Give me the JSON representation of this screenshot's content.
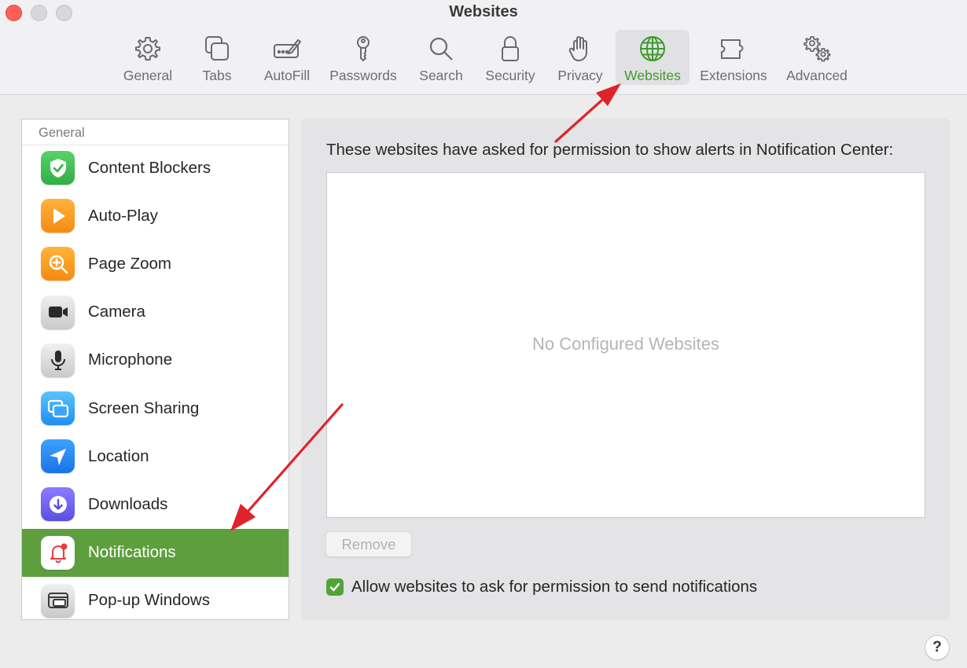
{
  "window": {
    "title": "Websites"
  },
  "toolbar": {
    "items": [
      {
        "label": "General",
        "icon": "gear-icon"
      },
      {
        "label": "Tabs",
        "icon": "tabs-icon"
      },
      {
        "label": "AutoFill",
        "icon": "autofill-icon"
      },
      {
        "label": "Passwords",
        "icon": "key-icon"
      },
      {
        "label": "Search",
        "icon": "search-icon"
      },
      {
        "label": "Security",
        "icon": "lock-icon"
      },
      {
        "label": "Privacy",
        "icon": "hand-icon"
      },
      {
        "label": "Websites",
        "icon": "globe-icon",
        "active": true
      },
      {
        "label": "Extensions",
        "icon": "puzzle-icon"
      },
      {
        "label": "Advanced",
        "icon": "gears-icon"
      }
    ]
  },
  "sidebar": {
    "header": "General",
    "items": [
      {
        "label": "Content Blockers",
        "icon": "shield-check-icon"
      },
      {
        "label": "Auto-Play",
        "icon": "play-icon"
      },
      {
        "label": "Page Zoom",
        "icon": "zoom-icon"
      },
      {
        "label": "Camera",
        "icon": "camera-icon"
      },
      {
        "label": "Microphone",
        "icon": "microphone-icon"
      },
      {
        "label": "Screen Sharing",
        "icon": "screen-sharing-icon"
      },
      {
        "label": "Location",
        "icon": "location-arrow-icon"
      },
      {
        "label": "Downloads",
        "icon": "download-icon"
      },
      {
        "label": "Notifications",
        "icon": "bell-icon",
        "selected": true
      },
      {
        "label": "Pop-up Windows",
        "icon": "popup-window-icon"
      }
    ]
  },
  "content": {
    "heading": "These websites have asked for permission to show alerts in Notification Center:",
    "empty_message": "No Configured Websites",
    "remove_label": "Remove",
    "allow_label": "Allow websites to ask for permission to send notifications",
    "allow_checked": true
  },
  "help": {
    "label": "?"
  },
  "colors": {
    "accent_green": "#3f9a2e",
    "selection_green": "#5e9f3d",
    "annotation_red": "#e1222a"
  }
}
